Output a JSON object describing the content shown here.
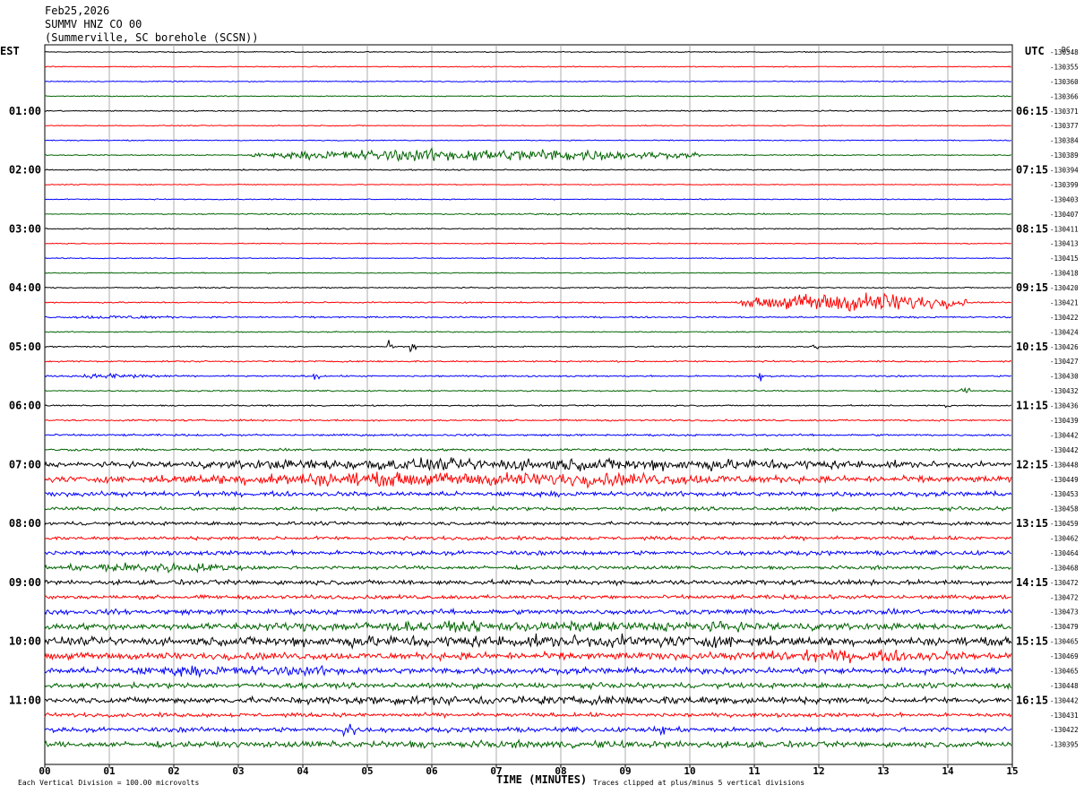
{
  "header": {
    "date": "Feb25,2026",
    "station": "SUMMV HNZ CO 00",
    "location": "(Summerville, SC borehole (SCSN))"
  },
  "axes": {
    "left_label": "EST",
    "right_label": "UTC",
    "dc_label": "DC",
    "xlabel": "TIME (MINUTES)"
  },
  "footer": {
    "scale_note": "Each Vertical Division =  100.00 microvolts",
    "clip_note": "Traces clipped at plus/minus 5 vertical divisions"
  },
  "chart_data": {
    "type": "line",
    "title": "SUMMV HNZ CO 00",
    "xlabel": "TIME (MINUTES)",
    "ylabel": "",
    "xlim": [
      0,
      15
    ],
    "x_ticks": [
      "00",
      "01",
      "02",
      "03",
      "04",
      "05",
      "06",
      "07",
      "08",
      "09",
      "10",
      "11",
      "12",
      "13",
      "14",
      "15"
    ],
    "traces_per_hour": 4,
    "trace_colors": [
      "#000000",
      "#ff0000",
      "#0000ff",
      "#006400"
    ],
    "est_hour_labels": [
      "01:00",
      "02:00",
      "03:00",
      "04:00",
      "05:00",
      "06:00",
      "07:00",
      "08:00",
      "09:00",
      "10:00",
      "11:00"
    ],
    "utc_hour_labels": [
      "06:15",
      "07:15",
      "08:15",
      "09:15",
      "10:15",
      "11:15",
      "12:15",
      "13:15",
      "14:15",
      "15:15",
      "16:15"
    ],
    "dc_offsets": [
      "-130348",
      "-130355",
      "-130360",
      "-130366",
      "-130371",
      "-130377",
      "-130384",
      "-130389",
      "-130394",
      "-130399",
      "-130403",
      "-130407",
      "-130411",
      "-130413",
      "-130415",
      "-130418",
      "-130420",
      "-130421",
      "-130422",
      "-130424",
      "-130426",
      "-130427",
      "-130430",
      "-130432",
      "-130436",
      "-130439",
      "-130442",
      "-130442",
      "-130448",
      "-130449",
      "-130453",
      "-130458",
      "-130459",
      "-130462",
      "-130464",
      "-130468",
      "-130472",
      "-130472",
      "-130473",
      "-130479",
      "-130465",
      "-130469",
      "-130465",
      "-130448",
      "-130442",
      "-130431",
      "-130422",
      "-130395"
    ],
    "trace_base_noise": [
      0.25,
      0.25,
      0.25,
      0.25,
      0.3,
      0.25,
      0.25,
      0.3,
      0.3,
      0.25,
      0.25,
      0.25,
      0.3,
      0.25,
      0.25,
      0.25,
      0.3,
      0.35,
      0.4,
      0.3,
      0.3,
      0.4,
      0.4,
      0.35,
      0.35,
      0.45,
      0.5,
      0.6,
      1.2,
      1.6,
      1.2,
      0.9,
      0.9,
      0.9,
      1.1,
      0.9,
      1.2,
      1.0,
      1.3,
      1.6,
      2.0,
      1.8,
      1.6,
      1.3,
      1.5,
      1.0,
      1.2,
      1.4
    ],
    "events": [
      {
        "trace": 7,
        "start_min": 3.2,
        "end_min": 10.2,
        "amplitude_div": 3.2
      },
      {
        "trace": 11,
        "start_min": 0.0,
        "end_min": 15.0,
        "amplitude_div": 0.4
      },
      {
        "trace": 17,
        "start_min": 10.8,
        "end_min": 14.3,
        "amplitude_div": 5.0
      },
      {
        "trace": 18,
        "start_min": 0.2,
        "end_min": 2.2,
        "amplitude_div": 1.0
      },
      {
        "trace": 20,
        "start_min": 5.3,
        "end_min": 5.4,
        "amplitude_div": 3.0
      },
      {
        "trace": 20,
        "start_min": 5.65,
        "end_min": 5.75,
        "amplitude_div": 3.0
      },
      {
        "trace": 20,
        "start_min": 11.9,
        "end_min": 12.0,
        "amplitude_div": 1.5
      },
      {
        "trace": 21,
        "start_min": 0.0,
        "end_min": 15.0,
        "amplitude_div": 0.3
      },
      {
        "trace": 22,
        "start_min": 0.4,
        "end_min": 2.0,
        "amplitude_div": 1.4
      },
      {
        "trace": 22,
        "start_min": 4.15,
        "end_min": 4.25,
        "amplitude_div": 3.0
      },
      {
        "trace": 22,
        "start_min": 11.05,
        "end_min": 11.15,
        "amplitude_div": 3.0
      },
      {
        "trace": 23,
        "start_min": 14.2,
        "end_min": 14.35,
        "amplitude_div": 2.0
      },
      {
        "trace": 24,
        "start_min": 13.95,
        "end_min": 14.05,
        "amplitude_div": 1.5
      },
      {
        "trace": 28,
        "start_min": 0.5,
        "end_min": 15.0,
        "amplitude_div": 3.0
      },
      {
        "trace": 29,
        "start_min": 0.5,
        "end_min": 12.5,
        "amplitude_div": 3.5
      },
      {
        "trace": 35,
        "start_min": 0.0,
        "end_min": 3.4,
        "amplitude_div": 2.5
      },
      {
        "trace": 39,
        "start_min": 0.0,
        "end_min": 15.0,
        "amplitude_div": 2.5
      },
      {
        "trace": 40,
        "start_min": 0.0,
        "end_min": 15.0,
        "amplitude_div": 3.0
      },
      {
        "trace": 41,
        "start_min": 10.0,
        "end_min": 15.0,
        "amplitude_div": 3.0
      },
      {
        "trace": 42,
        "start_min": 0.0,
        "end_min": 6.0,
        "amplitude_div": 2.5
      },
      {
        "trace": 44,
        "start_min": 0.0,
        "end_min": 15.0,
        "amplitude_div": 2.2
      },
      {
        "trace": 46,
        "start_min": 4.6,
        "end_min": 4.8,
        "amplitude_div": 5.0
      },
      {
        "trace": 46,
        "start_min": 9.55,
        "end_min": 9.65,
        "amplitude_div": 5.0
      },
      {
        "trace": 47,
        "start_min": 0.0,
        "end_min": 15.0,
        "amplitude_div": 1.8
      }
    ]
  }
}
